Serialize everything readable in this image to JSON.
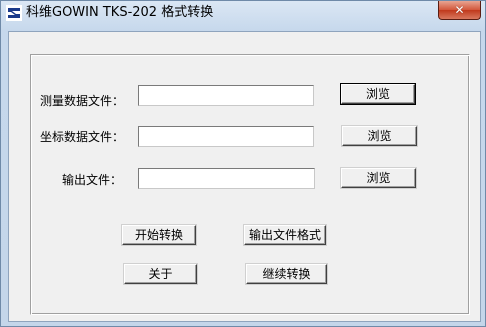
{
  "window": {
    "title": "科维GOWIN TKS-202 格式转换",
    "close_label": "✕"
  },
  "icons": {
    "app": "app-logo-icon",
    "close": "close-icon"
  },
  "form": {
    "survey_file_label": "测量数据文件：",
    "survey_file_value": "",
    "coord_file_label": "坐标数据文件：",
    "coord_file_value": "",
    "output_file_label": "输出文件：",
    "output_file_value": "",
    "browse_label": "浏览"
  },
  "actions": {
    "start_convert": "开始转换",
    "output_format": "输出文件格式",
    "about": "关于",
    "continue_convert": "继续转换"
  },
  "colors": {
    "title_bar": "#c6d8ec",
    "close_button": "#c84a2c",
    "client_bg": "#f0f0f0",
    "app_icon": "#1a3a8a"
  }
}
